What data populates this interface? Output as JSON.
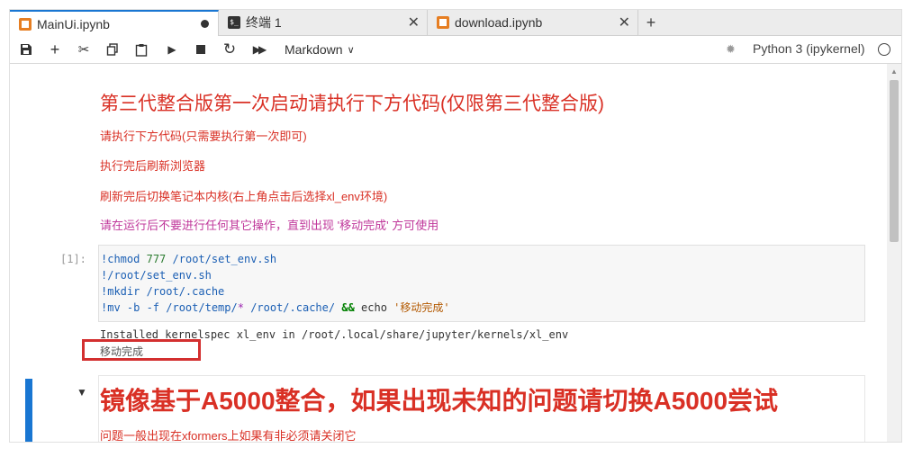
{
  "tabs": [
    {
      "label": "MainUi.ipynb",
      "icon": "notebook-icon",
      "state": "modified"
    },
    {
      "label": "终端 1",
      "icon": "terminal-icon"
    },
    {
      "label": "download.ipynb",
      "icon": "notebook-icon"
    }
  ],
  "toolbar": {
    "cell_type": "Markdown",
    "kernel_name": "Python 3 (ipykernel)",
    "icons": [
      "save-icon",
      "add-cell-icon",
      "cut-icon",
      "copy-icon",
      "paste-icon",
      "run-icon",
      "stop-icon",
      "restart-icon",
      "run-all-icon"
    ]
  },
  "cells": {
    "md1": {
      "heading": "第三代整合版第一次启动请执行下方代码(仅限第三代整合版)",
      "lines": [
        "请执行下方代码(只需要执行第一次即可)",
        "执行完后刷新浏览器",
        "刷新完后切换笔记本内核(右上角点击后选择xl_env环境)",
        "请在运行后不要进行任何其它操作，直到出现 '移动完成' 方可使用"
      ]
    },
    "code1": {
      "prompt": "[1]:",
      "lines": [
        "!chmod 777 /root/set_env.sh",
        "!/root/set_env.sh",
        "!mkdir /root/.cache",
        "!mv -b -f /root/temp/* /root/.cache/ && echo '移动完成'"
      ],
      "output": [
        "Installed kernelspec xl_env in /root/.local/share/jupyter/kernels/xl_env",
        "移动完成"
      ]
    },
    "md2": {
      "heading": "镜像基于A5000整合，如果出现未知的问题请切换A5000尝试",
      "line": "问题一般出现在xformers上如果有非必须请关闭它"
    }
  },
  "colors": {
    "accent": "#1976d2",
    "markdown_red": "#d93025",
    "highlight_box": "#d32f2f"
  }
}
